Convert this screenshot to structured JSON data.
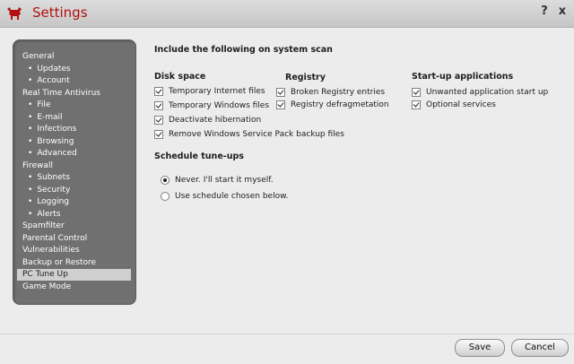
{
  "window": {
    "title": "Settings",
    "help_label": "?",
    "close_label": "x",
    "accent_color": "#b31010"
  },
  "sidebar": {
    "items": [
      {
        "label": "General",
        "sub": false,
        "selected": false
      },
      {
        "label": "Updates",
        "sub": true,
        "selected": false
      },
      {
        "label": "Account",
        "sub": true,
        "selected": false
      },
      {
        "label": "Real Time Antivirus",
        "sub": false,
        "selected": false
      },
      {
        "label": "File",
        "sub": true,
        "selected": false
      },
      {
        "label": "E-mail",
        "sub": true,
        "selected": false
      },
      {
        "label": "Infections",
        "sub": true,
        "selected": false
      },
      {
        "label": "Browsing",
        "sub": true,
        "selected": false
      },
      {
        "label": "Advanced",
        "sub": true,
        "selected": false
      },
      {
        "label": "Firewall",
        "sub": false,
        "selected": false
      },
      {
        "label": "Subnets",
        "sub": true,
        "selected": false
      },
      {
        "label": "Security",
        "sub": true,
        "selected": false
      },
      {
        "label": "Logging",
        "sub": true,
        "selected": false
      },
      {
        "label": "Alerts",
        "sub": true,
        "selected": false
      },
      {
        "label": "Spamfilter",
        "sub": false,
        "selected": false
      },
      {
        "label": "Parental Control",
        "sub": false,
        "selected": false
      },
      {
        "label": "Vulnerabilities",
        "sub": false,
        "selected": false
      },
      {
        "label": "Backup or Restore",
        "sub": false,
        "selected": false
      },
      {
        "label": "PC Tune Up",
        "sub": false,
        "selected": true
      },
      {
        "label": "Game Mode",
        "sub": false,
        "selected": false
      }
    ]
  },
  "main": {
    "heading": "Include the following on system scan",
    "disk_space": {
      "title": "Disk space",
      "options": [
        {
          "label": "Temporary Internet files",
          "checked": true
        },
        {
          "label": "Temporary Windows files",
          "checked": true
        },
        {
          "label": "Deactivate hibernation",
          "checked": true
        },
        {
          "label": "Remove Windows Service Pack backup files",
          "checked": true
        }
      ]
    },
    "registry": {
      "title": "Registry",
      "options": [
        {
          "label": "Broken Registry entries",
          "checked": true
        },
        {
          "label": "Registry defragmetation",
          "checked": true
        }
      ]
    },
    "startup": {
      "title": "Start-up applications",
      "options": [
        {
          "label": "Unwanted application start up",
          "checked": true
        },
        {
          "label": "Optional services",
          "checked": true
        }
      ]
    },
    "schedule": {
      "title": "Schedule tune-ups",
      "options": [
        {
          "label": "Never. I'll start it myself.",
          "selected": true
        },
        {
          "label": "Use schedule chosen below.",
          "selected": false
        }
      ]
    }
  },
  "footer": {
    "save_label": "Save",
    "cancel_label": "Cancel"
  }
}
